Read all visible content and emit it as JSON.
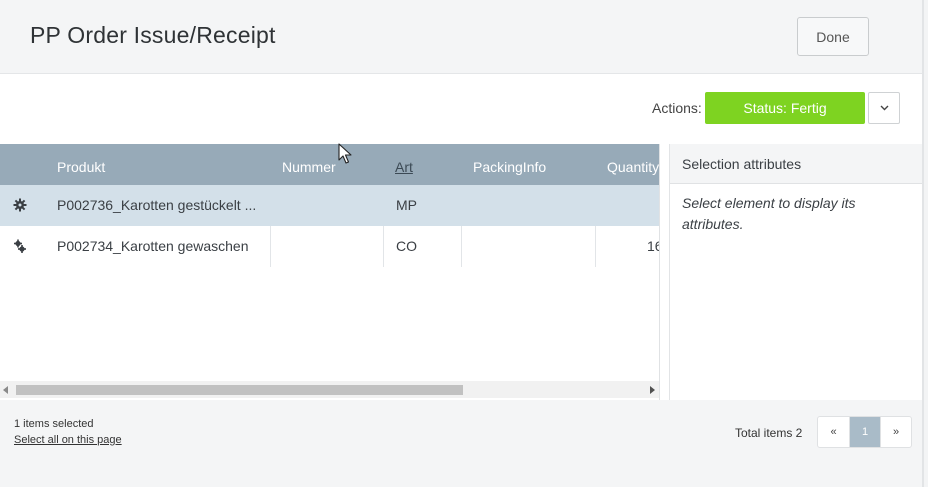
{
  "header": {
    "title": "PP Order Issue/Receipt",
    "done_label": "Done"
  },
  "actions": {
    "label": "Actions:",
    "status_button": "Status: Fertig",
    "dropdown_icon": "chevron-down-icon",
    "status_color": "#7ed321"
  },
  "grid": {
    "columns": [
      "Produkt",
      "Nummer",
      "Art",
      "PackingInfo",
      "Quantity"
    ],
    "sorted_column": "Art",
    "header_color": "#97aab8",
    "rows": [
      {
        "icon": "gear-icon",
        "produkt": "P002736_Karotten gestückelt ...",
        "nummer": "",
        "art": "MP",
        "packing": "",
        "quantity": "",
        "selected": true
      },
      {
        "icon": "component-gear-icon",
        "produkt": "P002734_Karotten gewaschen",
        "nummer": "",
        "art": "CO",
        "packing": "",
        "quantity": "16",
        "selected": false
      }
    ]
  },
  "attributes": {
    "title": "Selection attributes",
    "hint": "Select element to display its attributes."
  },
  "footer": {
    "selected_text": "1 items selected",
    "select_all": "Select all on this page",
    "total": "Total items 2",
    "pager": {
      "prev": "«",
      "current": "1",
      "next": "»"
    }
  }
}
